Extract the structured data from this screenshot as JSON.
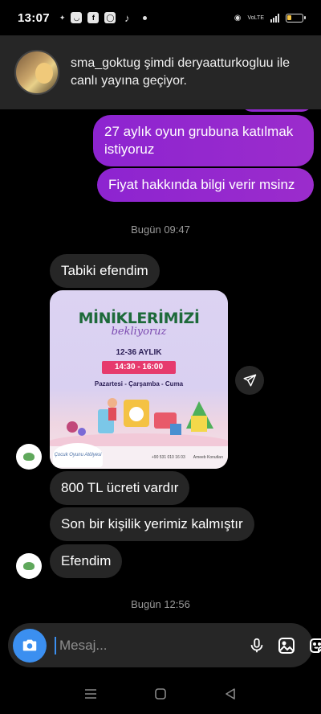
{
  "status_bar": {
    "time": "13:07",
    "network_label": "VoLTE",
    "icons": [
      "gallery-icon",
      "messenger-icon",
      "facebook-icon",
      "chat-icon",
      "tiktok-icon"
    ]
  },
  "live_banner": {
    "text": "sma_goktug şimdi deryaatturkogluu ile canlı yayına geçiyor."
  },
  "messages_out": [
    {
      "text": "27 aylık oyun grubuna katılmak istiyoruz"
    },
    {
      "text": "Fiyat hakkında bilgi verir msinz"
    }
  ],
  "timestamps": [
    "Bugün 09:47",
    "Bugün 12:56"
  ],
  "messages_in": [
    {
      "text": "Tabiki efendim"
    },
    {
      "text": "800 TL ücreti vardır"
    },
    {
      "text": "Son bir kişilik yerimiz kalmıştır"
    },
    {
      "text": "Efendim"
    }
  ],
  "poster": {
    "title": "MİNİKLERİMİZİ",
    "subtitle": "bekliyoruz",
    "age": "12-36 AYLIK",
    "hours": "14:30 - 16:00",
    "days": "Pazartesi - Çarşamba - Cuma",
    "logo_text": "Çocuk Oyunu Atölyesi",
    "phone": "+90 531 010 16 03",
    "location": "Ameeb Konutları"
  },
  "composer": {
    "placeholder": "Mesaj..."
  },
  "colors": {
    "outgoing_bubble": "#8d24d0",
    "incoming_bubble": "#262626",
    "accent": "#3b8ff0"
  }
}
